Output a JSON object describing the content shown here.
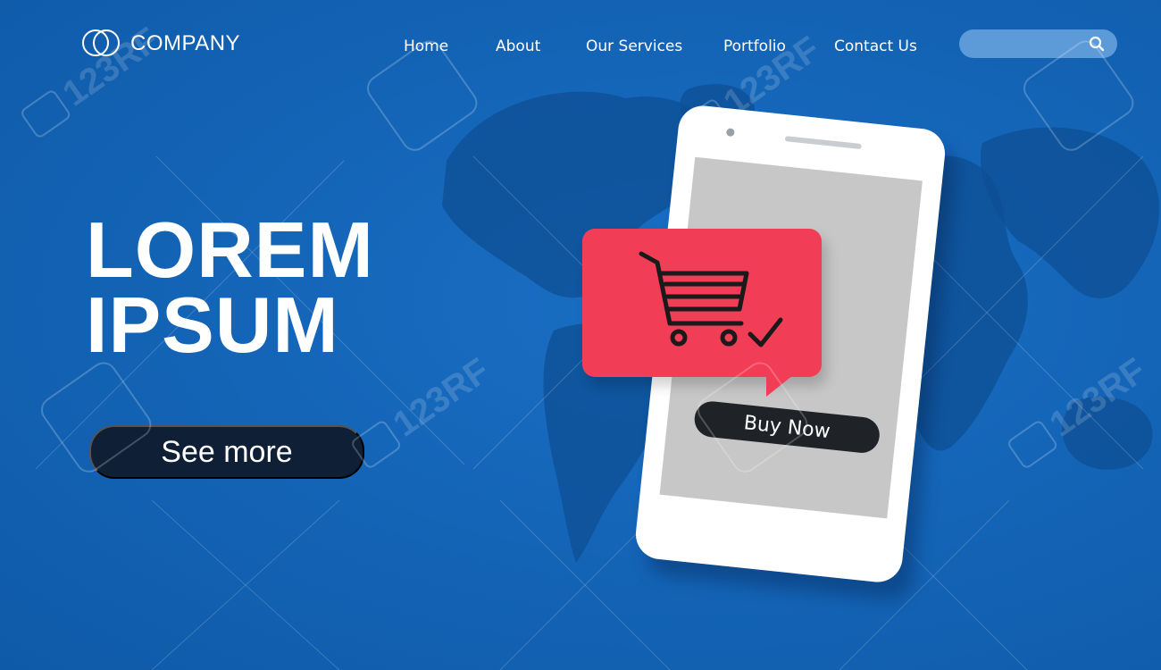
{
  "brand": {
    "name": "COMPANY",
    "logo_icon": "interlocking-circles-icon"
  },
  "nav": {
    "items": [
      {
        "label": "Home"
      },
      {
        "label": "About"
      },
      {
        "label": "Our Services"
      },
      {
        "label": "Portfolio"
      },
      {
        "label": "Contact Us"
      }
    ]
  },
  "search": {
    "value": "",
    "placeholder": "",
    "icon": "search-icon"
  },
  "hero": {
    "title": "LOREM\nIPSUM",
    "cta_label": "See more"
  },
  "phone": {
    "buy_button_label": "Buy Now",
    "notification_icon": "shopping-cart-check-icon"
  },
  "watermark": {
    "text": "123RF"
  },
  "colors": {
    "background": "#1465b8",
    "map": "#0e4f94",
    "cta_button": "#0f1f36",
    "notification": "#f23d57",
    "buy_button": "#1f2328",
    "phone_body": "#ffffff",
    "phone_screen": "#c7c7c7",
    "search_box": "#5d9ad8"
  }
}
